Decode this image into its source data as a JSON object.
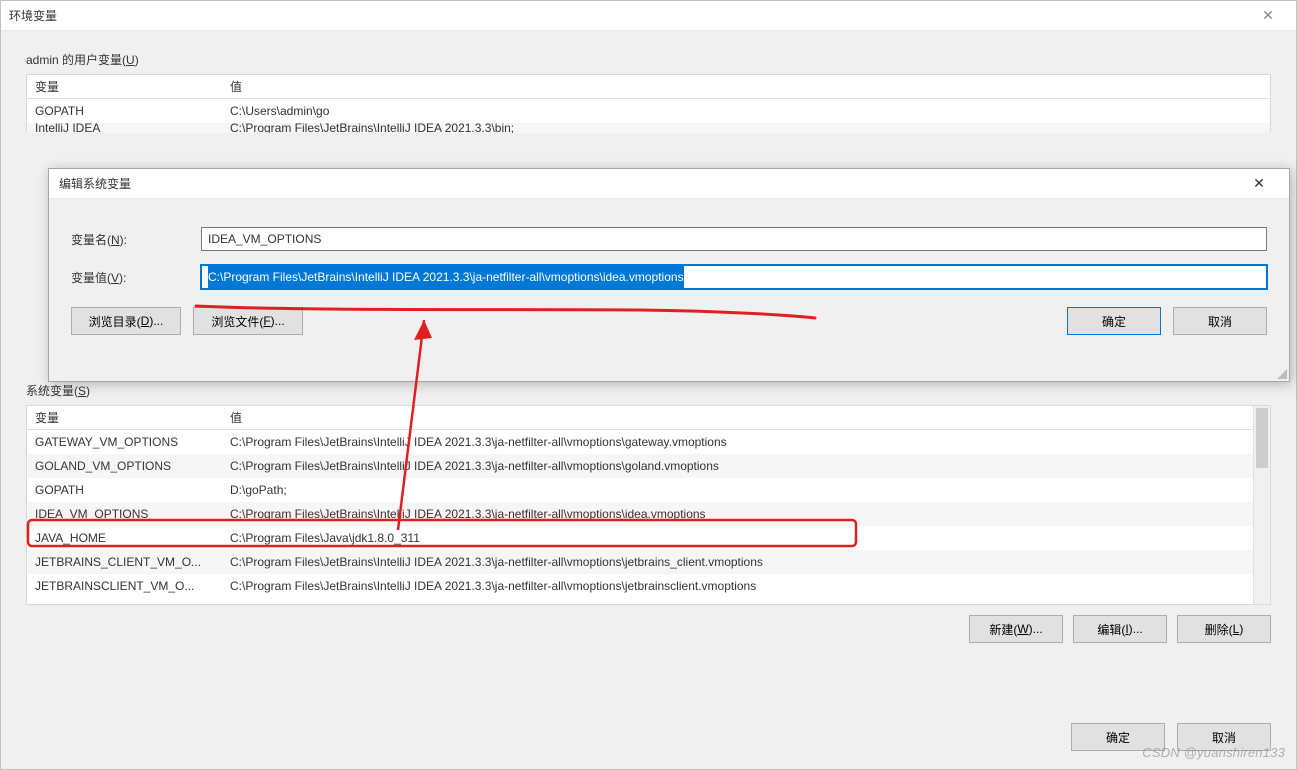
{
  "mainWindow": {
    "title": "环境变量",
    "close": "✕"
  },
  "userVars": {
    "sectionLabel_prefix": "admin 的用户变量(",
    "sectionLabel_u": "U",
    "sectionLabel_suffix": ")",
    "header": {
      "col1": "变量",
      "col2": "值"
    },
    "rows": [
      {
        "name": "GOPATH",
        "value": "C:\\Users\\admin\\go"
      },
      {
        "name": "IntelliJ IDEA",
        "value": "C:\\Program Files\\JetBrains\\IntelliJ IDEA 2021.3.3\\bin;"
      }
    ]
  },
  "editDialog": {
    "title": "编辑系统变量",
    "close": "✕",
    "nameLabel_prefix": "变量名(",
    "nameLabel_u": "N",
    "nameLabel_suffix": "):",
    "nameValue": "IDEA_VM_OPTIONS",
    "valueLabel_prefix": "变量值(",
    "valueLabel_u": "V",
    "valueLabel_suffix": "):",
    "valueValue": "C:\\Program Files\\JetBrains\\IntelliJ IDEA 2021.3.3\\ja-netfilter-all\\vmoptions\\idea.vmoptions",
    "browseDir_prefix": "浏览目录(",
    "browseDir_u": "D",
    "browseDir_suffix": ")...",
    "browseFile_prefix": "浏览文件(",
    "browseFile_u": "F",
    "browseFile_suffix": ")...",
    "ok": "确定",
    "cancel": "取消"
  },
  "sysVars": {
    "sectionLabel_prefix": "系统变量(",
    "sectionLabel_u": "S",
    "sectionLabel_suffix": ")",
    "header": {
      "col1": "变量",
      "col2": "值"
    },
    "rows": [
      {
        "name": "GATEWAY_VM_OPTIONS",
        "value": "C:\\Program Files\\JetBrains\\IntelliJ IDEA 2021.3.3\\ja-netfilter-all\\vmoptions\\gateway.vmoptions"
      },
      {
        "name": "GOLAND_VM_OPTIONS",
        "value": "C:\\Program Files\\JetBrains\\IntelliJ IDEA 2021.3.3\\ja-netfilter-all\\vmoptions\\goland.vmoptions"
      },
      {
        "name": "GOPATH",
        "value": "D:\\goPath;"
      },
      {
        "name": "IDEA_VM_OPTIONS",
        "value": "C:\\Program Files\\JetBrains\\IntelliJ IDEA 2021.3.3\\ja-netfilter-all\\vmoptions\\idea.vmoptions"
      },
      {
        "name": "JAVA_HOME",
        "value": "C:\\Program Files\\Java\\jdk1.8.0_311"
      },
      {
        "name": "JETBRAINS_CLIENT_VM_O...",
        "value": "C:\\Program Files\\JetBrains\\IntelliJ IDEA 2021.3.3\\ja-netfilter-all\\vmoptions\\jetbrains_client.vmoptions"
      },
      {
        "name": "JETBRAINSCLIENT_VM_O...",
        "value": "C:\\Program Files\\JetBrains\\IntelliJ IDEA 2021.3.3\\ja-netfilter-all\\vmoptions\\jetbrainsclient.vmoptions"
      }
    ],
    "new_prefix": "新建(",
    "new_u": "W",
    "new_suffix": ")...",
    "edit_prefix": "编辑(",
    "edit_u": "I",
    "edit_suffix": ")...",
    "del_prefix": "删除(",
    "del_u": "L",
    "del_suffix": ")"
  },
  "bottom": {
    "ok": "确定",
    "cancel": "取消"
  },
  "watermark": "CSDN @yuanshiren133"
}
